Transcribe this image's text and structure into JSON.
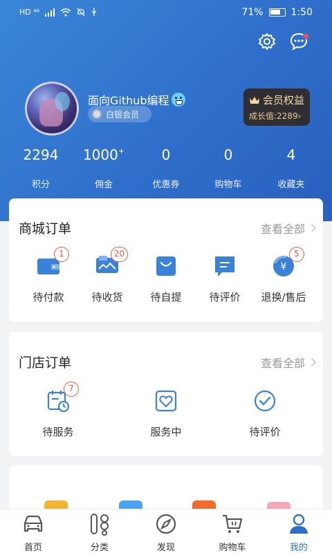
{
  "status_bar": {
    "left_indicators": "HD ⁴⁶",
    "battery": "71%",
    "time": "1:50"
  },
  "header": {
    "username": "面向Github编程",
    "member_level": "白银会员",
    "vip": {
      "title": "会员权益",
      "growth": "成长值:2289"
    },
    "colors": {
      "header_bg": "#2f6fcb",
      "vip_bg": "#2f2f33",
      "vip_text": "#f3d9a4"
    }
  },
  "stats": [
    {
      "value": "2294",
      "sup": "",
      "label": "积分"
    },
    {
      "value": "1000",
      "sup": "+",
      "label": "佣金"
    },
    {
      "value": "0",
      "sup": "",
      "label": "优惠券"
    },
    {
      "value": "0",
      "sup": "",
      "label": "购物车"
    },
    {
      "value": "4",
      "sup": "",
      "label": "收藏夹"
    }
  ],
  "mall_orders": {
    "title": "商城订单",
    "more": "查看全部",
    "items": [
      {
        "label": "待付款",
        "badge": "1",
        "icon": "wallet-icon"
      },
      {
        "label": "待收货",
        "badge": "20",
        "icon": "package-icon"
      },
      {
        "label": "待自提",
        "badge": "",
        "icon": "shopping-bag-icon"
      },
      {
        "label": "待评价",
        "badge": "",
        "icon": "comment-icon"
      },
      {
        "label": "退换/售后",
        "badge": "5",
        "icon": "refund-icon"
      }
    ]
  },
  "store_orders": {
    "title": "门店订单",
    "more": "查看全部",
    "items": [
      {
        "label": "待服务",
        "badge": "7",
        "icon": "calendar-clock-icon"
      },
      {
        "label": "服务中",
        "badge": "",
        "icon": "heart-frame-icon"
      },
      {
        "label": "待评价",
        "badge": "",
        "icon": "check-circle-icon"
      }
    ]
  },
  "tabbar": [
    {
      "label": "首页",
      "icon": "car-icon",
      "active": false
    },
    {
      "label": "分类",
      "icon": "category-icon",
      "active": false
    },
    {
      "label": "发现",
      "icon": "compass-icon",
      "active": false
    },
    {
      "label": "购物车",
      "icon": "cart-icon",
      "active": false
    },
    {
      "label": "我的",
      "icon": "user-icon",
      "active": true
    }
  ],
  "accent": "#2f6fcb",
  "badge_color": "#ef5a3c",
  "icon_color": "#3a82d8"
}
